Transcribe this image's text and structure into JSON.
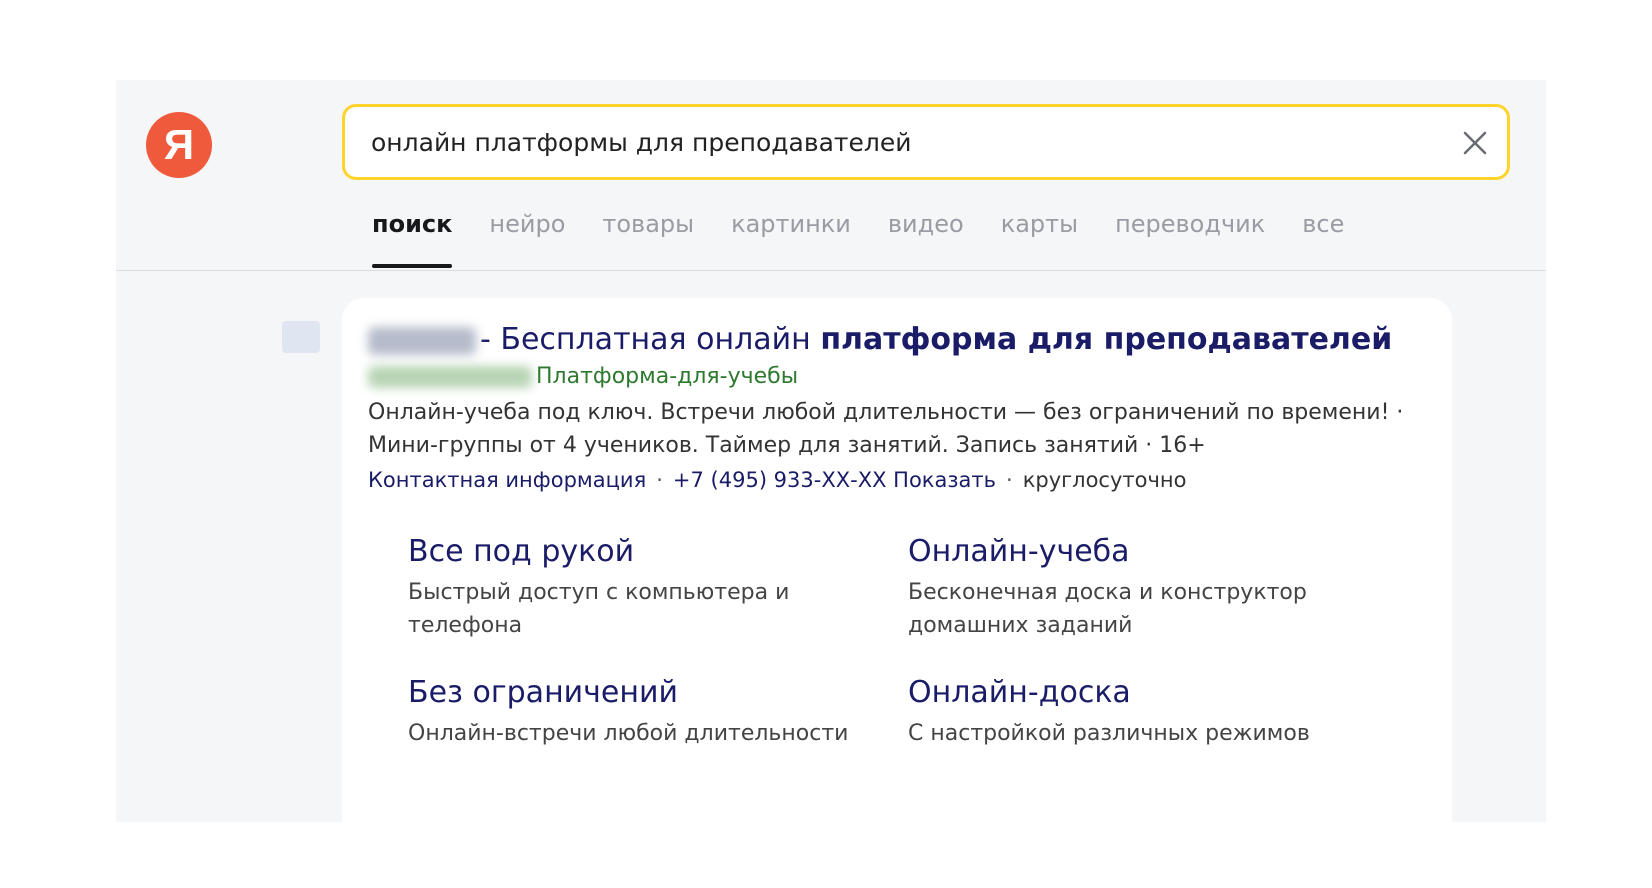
{
  "logo": {
    "letter": "Я"
  },
  "search": {
    "query": "онлайн платформы для преподавателей"
  },
  "tabs": [
    {
      "label": "поиск",
      "active": true
    },
    {
      "label": "нейро"
    },
    {
      "label": "товары"
    },
    {
      "label": "картинки"
    },
    {
      "label": "видео"
    },
    {
      "label": "карты"
    },
    {
      "label": "переводчик"
    },
    {
      "label": "все"
    }
  ],
  "result": {
    "title_prefix": "- Бесплатная онлайн ",
    "title_bold": "платформа для преподавателей",
    "url_path": "Платформа-для-учебы",
    "description": "Онлайн-учеба под ключ. Встречи любой длительности — без ограничений по времени! · Мини-группы от 4 учеников. Таймер для занятий. Запись занятий · 16+",
    "contacts": {
      "contact_info": "Контактная информация",
      "phone": "+7 (495) 933-ХХ-ХХ",
      "show": "Показать",
      "hours": "круглосуточно"
    },
    "sitelinks": [
      {
        "title": "Все под рукой",
        "desc": "Быстрый доступ с компьютера и телефона"
      },
      {
        "title": "Онлайн-учеба",
        "desc": "Бесконечная доска и конструктор домашних заданий"
      },
      {
        "title": "Без ограничений",
        "desc": "Онлайн-встречи любой длительности"
      },
      {
        "title": "Онлайн-доска",
        "desc": "С настройкой различных режимов"
      }
    ]
  },
  "colors": {
    "search_border": "#fed42b",
    "logo_red": "#f05a3c",
    "link_blue": "#1a1c68",
    "url_green": "#2d7a2f"
  }
}
